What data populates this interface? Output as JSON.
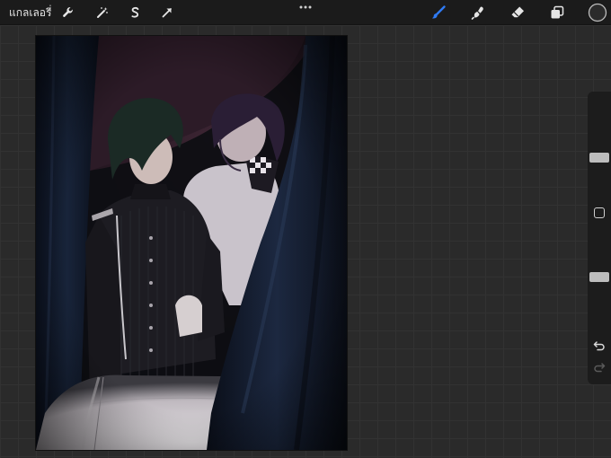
{
  "toolbar": {
    "gallery_label": "แกลเลอรี่",
    "tools_left": [
      {
        "name": "actions",
        "icon": "wrench-icon"
      },
      {
        "name": "adjustments",
        "icon": "magic-wand-icon"
      },
      {
        "name": "selection",
        "icon": "selection-s-icon"
      },
      {
        "name": "transform",
        "icon": "arrow-cursor-icon"
      }
    ],
    "tools_right": [
      {
        "name": "brush",
        "icon": "brush-icon",
        "active": true
      },
      {
        "name": "smudge",
        "icon": "smudge-icon"
      },
      {
        "name": "eraser",
        "icon": "eraser-icon"
      },
      {
        "name": "layers",
        "icon": "layers-icon"
      },
      {
        "name": "color",
        "icon": "color-swatch"
      }
    ],
    "active_color": "#2f7bf5",
    "current_color": "#2b2b2b"
  },
  "sidebar": {
    "brush_size_level": 0.35,
    "opacity_level": 0.55
  }
}
